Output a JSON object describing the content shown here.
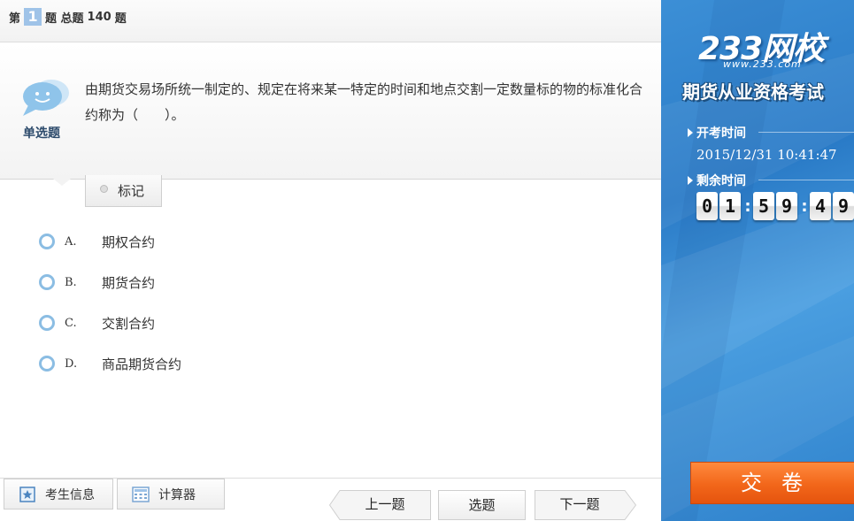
{
  "header": {
    "prefix": "第",
    "current": "1",
    "middle": "题 总题",
    "total": "140",
    "suffix": "题"
  },
  "question": {
    "type_label": "单选题",
    "text": "由期货交易场所统一制定的、规定在将来某一特定的时间和地点交割一定数量标的物的标准化合约称为（　　）。",
    "mark_label": "标记"
  },
  "options": [
    {
      "letter": "A.",
      "text": "期权合约"
    },
    {
      "letter": "B.",
      "text": "期货合约"
    },
    {
      "letter": "C.",
      "text": "交割合约"
    },
    {
      "letter": "D.",
      "text": "商品期货合约"
    }
  ],
  "toolbar": {
    "candidate_info": "考生信息",
    "calculator": "计算器"
  },
  "nav": {
    "prev": "上一题",
    "select": "选题",
    "next": "下一题"
  },
  "sidebar": {
    "logo": "233网校",
    "url": "www.233.com",
    "exam_name": "期货从业资格考试",
    "start_label": "开考时间",
    "start_time": "2015/12/31 10:41:47",
    "remaining_label": "剩余时间",
    "timer": [
      "0",
      "1",
      "5",
      "9",
      "4",
      "9"
    ],
    "submit": "交卷"
  },
  "colors": {
    "accent": "#8bbde3",
    "sidebar": "#2f82cc",
    "submit": "#f2661a"
  }
}
